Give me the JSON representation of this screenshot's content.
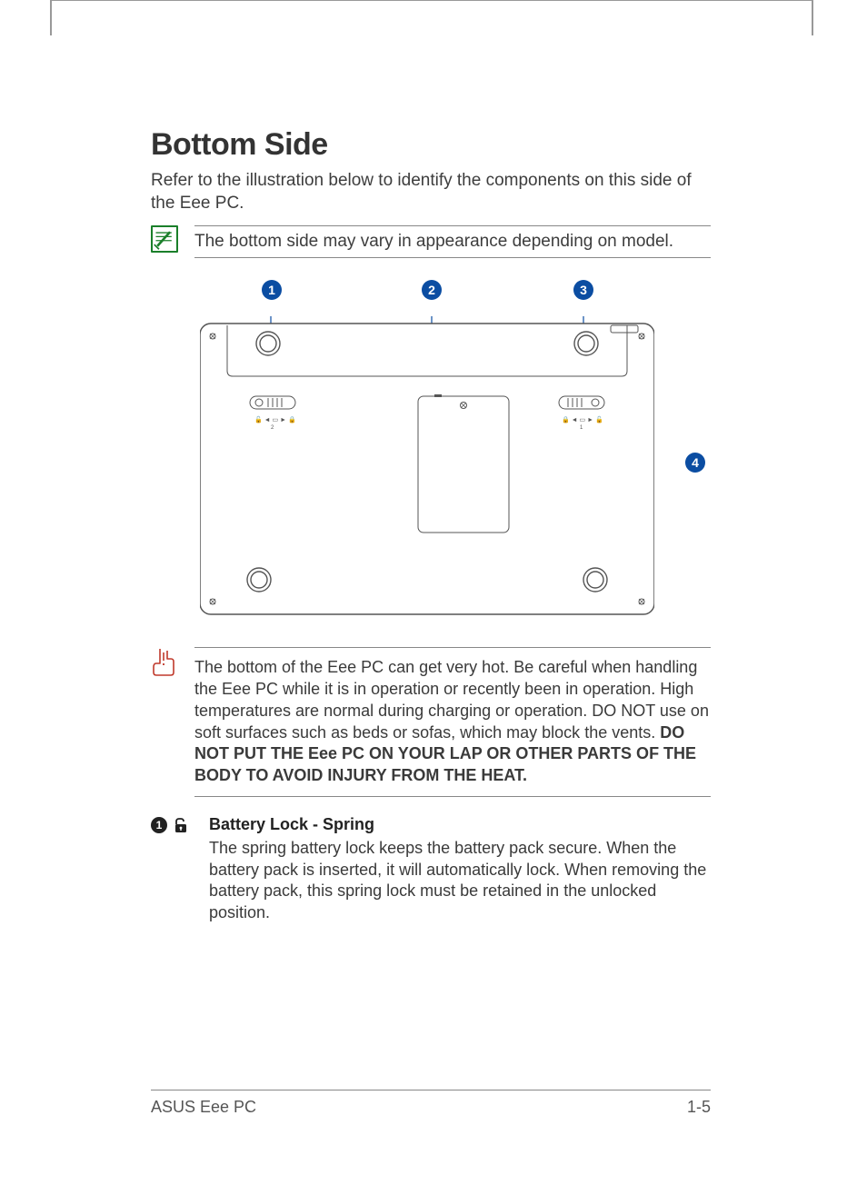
{
  "title": "Bottom Side",
  "intro": "Refer to the illustration below to identify the components on this side of the Eee PC.",
  "note": {
    "text": "The bottom side may vary in appearance depending on model."
  },
  "diagram": {
    "callouts": [
      "1",
      "2",
      "3",
      "4"
    ]
  },
  "warning": {
    "text_plain": "The bottom of the Eee PC can get very hot. Be careful when handling the Eee PC while it is in operation or recently been in operation. High temperatures are normal during charging or operation. DO NOT use on soft surfaces such as beds or sofas, which may block the vents. ",
    "text_bold": "DO NOT PUT THE Eee PC ON YOUR LAP OR OTHER PARTS OF THE BODY TO AVOID INJURY FROM THE HEAT."
  },
  "items": [
    {
      "num": "1",
      "title": "Battery Lock - Spring",
      "text": "The spring battery lock keeps the battery pack secure. When the battery pack is inserted, it will automatically lock. When removing the battery pack, this spring lock must be retained in the unlocked position."
    }
  ],
  "footer": {
    "left": "ASUS Eee PC",
    "right": "1-5"
  }
}
